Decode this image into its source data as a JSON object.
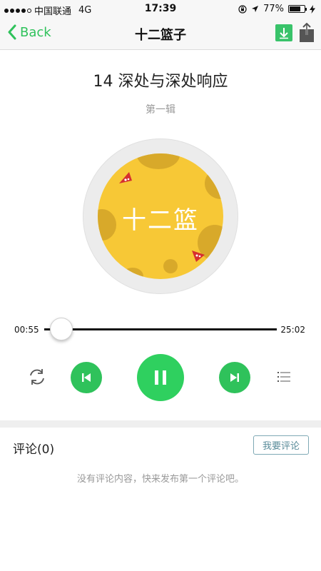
{
  "status_bar": {
    "carrier": "中国联通",
    "network": "4G",
    "time": "17:39",
    "battery_percent": "77%",
    "battery_level": 0.77
  },
  "nav": {
    "back_label": "Back",
    "title": "十二篮子"
  },
  "track": {
    "title": "14 深处与深处响应",
    "album": "第一辑"
  },
  "disc": {
    "cover_text": "十二篮",
    "colors": {
      "ring": "#ececec",
      "cover": "#f7c836",
      "crater": "#d8a92a",
      "cheese": "#d62f2f"
    }
  },
  "player": {
    "current_time": "00:55",
    "total_time": "25:02",
    "progress": 0.037,
    "accent": "#2fc25b"
  },
  "comments": {
    "title": "评论(0)",
    "write_button": "我要评论",
    "empty_text": "没有评论内容，快来发布第一个评论吧。"
  },
  "icons": [
    "chevron-left-icon",
    "download-icon",
    "share-icon",
    "repeat-icon",
    "previous-icon",
    "pause-icon",
    "next-icon",
    "playlist-icon",
    "location-arrow-icon",
    "orientation-lock-icon",
    "charging-bolt-icon"
  ]
}
